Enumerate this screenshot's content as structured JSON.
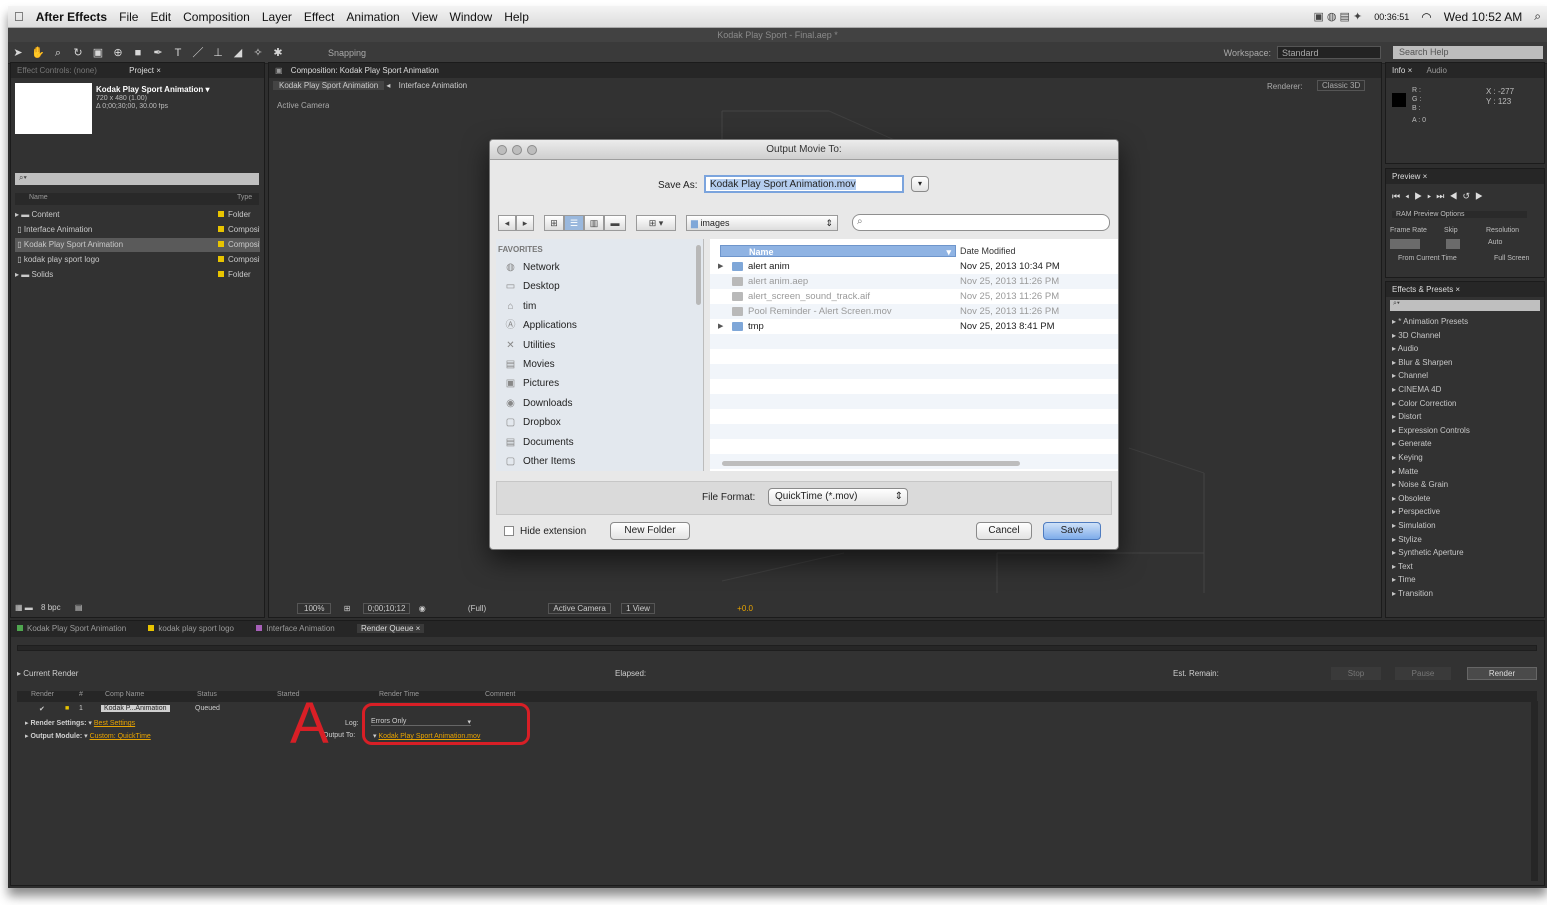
{
  "menubar": {
    "apple": "",
    "app_name": "After Effects",
    "items": [
      "File",
      "Edit",
      "Composition",
      "Layer",
      "Effect",
      "Animation",
      "View",
      "Window",
      "Help"
    ],
    "clock": "Wed 10:52 AM",
    "battery_timer": "00:36:51"
  },
  "window_title": "Kodak Play Sport - Final.aep *",
  "toolbar": {
    "snapping_label": "Snapping",
    "workspace_label": "Workspace:",
    "workspace_value": "Standard",
    "search_placeholder": "Search Help"
  },
  "project_panel": {
    "tabs": [
      "Effect Controls: (none)",
      "Project ×"
    ],
    "comp_name": "Kodak Play Sport Animation ▾",
    "comp_size": "720 x 480 (1.00)",
    "comp_duration": "Δ 0;00;30;00, 30.00 fps",
    "col_name": "Name",
    "col_type": "Type",
    "items": [
      {
        "name": "Content",
        "type": "Folder"
      },
      {
        "name": "Interface Animation",
        "type": "Composition"
      },
      {
        "name": "Kodak Play Sport Animation",
        "type": "Composition"
      },
      {
        "name": "kodak play sport logo",
        "type": "Composition"
      },
      {
        "name": "Solids",
        "type": "Folder"
      }
    ],
    "bpc": "8 bpc"
  },
  "comp_panel": {
    "tab": "Composition: Kodak Play Sport Animation",
    "subtabs": [
      "Kodak Play Sport Animation",
      "Interface Animation"
    ],
    "renderer_label": "Renderer:",
    "renderer_value": "Classic 3D",
    "view_label": "Active Camera",
    "zoom": "100%",
    "timecode": "0;00;10;12",
    "resolution": "(Full)",
    "camera": "Active Camera",
    "views": "1 View",
    "exposure": "+0.0"
  },
  "info_panel": {
    "tabs": [
      "Info ×",
      "Audio"
    ],
    "r": "R :",
    "g": "G :",
    "b": "B :",
    "a": "A : 0",
    "x": "X : -277",
    "y": "Y : 123"
  },
  "preview_panel": {
    "tab": "Preview ×",
    "ram_options": "RAM Preview Options",
    "frame_rate": "Frame Rate",
    "skip": "Skip",
    "resolution": "Resolution",
    "auto": "Auto",
    "from_current": "From Current Time",
    "full_screen": "Full Screen"
  },
  "effects_panel": {
    "tab": "Effects & Presets ×",
    "items": [
      "* Animation Presets",
      "3D Channel",
      "Audio",
      "Blur & Sharpen",
      "Channel",
      "CINEMA 4D",
      "Color Correction",
      "Distort",
      "Expression Controls",
      "Generate",
      "Keying",
      "Matte",
      "Noise & Grain",
      "Obsolete",
      "Perspective",
      "Simulation",
      "Stylize",
      "Synthetic Aperture",
      "Text",
      "Time",
      "Transition"
    ]
  },
  "dialog": {
    "title": "Output Movie To:",
    "save_as_label": "Save As:",
    "save_as_value": "Kodak Play Sport Animation.mov",
    "location": "images",
    "favorites_label": "FAVORITES",
    "favorites": [
      {
        "label": "Network",
        "icon": "network-icon"
      },
      {
        "label": "Desktop",
        "icon": "desktop-icon"
      },
      {
        "label": "tim",
        "icon": "home-icon"
      },
      {
        "label": "Applications",
        "icon": "applications-icon"
      },
      {
        "label": "Utilities",
        "icon": "utilities-icon"
      },
      {
        "label": "Movies",
        "icon": "movies-icon"
      },
      {
        "label": "Pictures",
        "icon": "pictures-icon"
      },
      {
        "label": "Downloads",
        "icon": "downloads-icon"
      },
      {
        "label": "Dropbox",
        "icon": "dropbox-icon"
      },
      {
        "label": "Documents",
        "icon": "documents-icon"
      },
      {
        "label": "Other Items",
        "icon": "folder-icon"
      }
    ],
    "col_name": "Name",
    "col_date": "Date Modified",
    "files": [
      {
        "name": "alert anim",
        "date": "Nov 25, 2013 10:34 PM",
        "folder": true,
        "dim": false
      },
      {
        "name": "alert anim.aep",
        "date": "Nov 25, 2013 11:26 PM",
        "folder": false,
        "dim": true
      },
      {
        "name": "alert_screen_sound_track.aif",
        "date": "Nov 25, 2013 11:26 PM",
        "folder": false,
        "dim": true
      },
      {
        "name": "Pool Reminder - Alert Screen.mov",
        "date": "Nov 25, 2013 11:26 PM",
        "folder": false,
        "dim": true
      },
      {
        "name": "tmp",
        "date": "Nov 25, 2013 8:41 PM",
        "folder": true,
        "dim": false
      }
    ],
    "file_format_label": "File Format:",
    "file_format_value": "QuickTime (*.mov)",
    "hide_extension": "Hide extension",
    "new_folder": "New Folder",
    "cancel": "Cancel",
    "save": "Save"
  },
  "timeline_tabs": [
    "Kodak Play Sport Animation",
    "kodak play sport logo",
    "Interface Animation",
    "Render Queue ×"
  ],
  "render_queue": {
    "current_render": "Current Render",
    "elapsed": "Elapsed:",
    "est_remain": "Est. Remain:",
    "stop": "Stop",
    "pause": "Pause",
    "render": "Render",
    "columns": [
      "Render",
      "#",
      "Comp Name",
      "Status",
      "Started",
      "Render Time",
      "Comment"
    ],
    "item_comp": "Kodak P...Animation",
    "item_status": "Queued",
    "render_settings_label": "Render Settings:",
    "render_settings_value": "Best Settings",
    "output_module_label": "Output Module:",
    "output_module_value": "Custom: QuickTime",
    "log_label": "Log:",
    "log_value": "Errors Only",
    "output_to_label": "Output To:",
    "output_to_value": "Kodak Play Sport Animation.mov"
  },
  "annotation_letter": "A"
}
